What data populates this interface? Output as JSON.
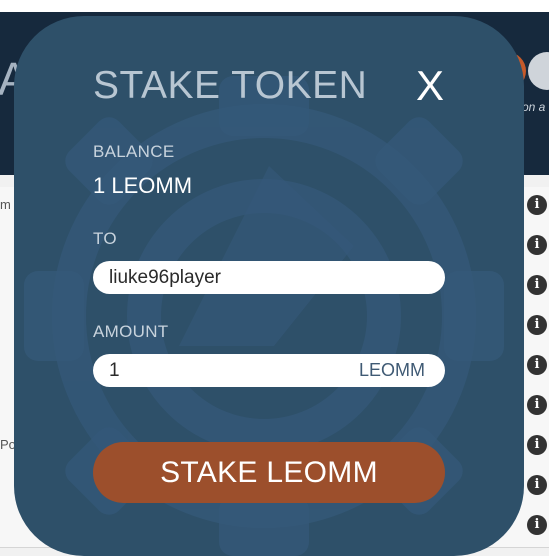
{
  "modal": {
    "title": "STAKE TOKEN",
    "close_label": "X",
    "balance_label": "BALANCE",
    "balance_value": "1 LEOMM",
    "to_label": "TO",
    "to_value": "liuke96player",
    "amount_label": "AMOUNT",
    "amount_value": "1",
    "amount_unit": "LEOMM",
    "submit_label": "STAKE LEOMM"
  },
  "background": {
    "header_fragment": "A",
    "header_small_text": "on a",
    "row_fragments": [
      "m",
      "",
      "",
      "",
      "",
      "",
      "Pok",
      ""
    ]
  },
  "colors": {
    "modal_bg": "#2e5069",
    "button_bg": "#9c4f2c",
    "header_bg": "#16293d"
  }
}
